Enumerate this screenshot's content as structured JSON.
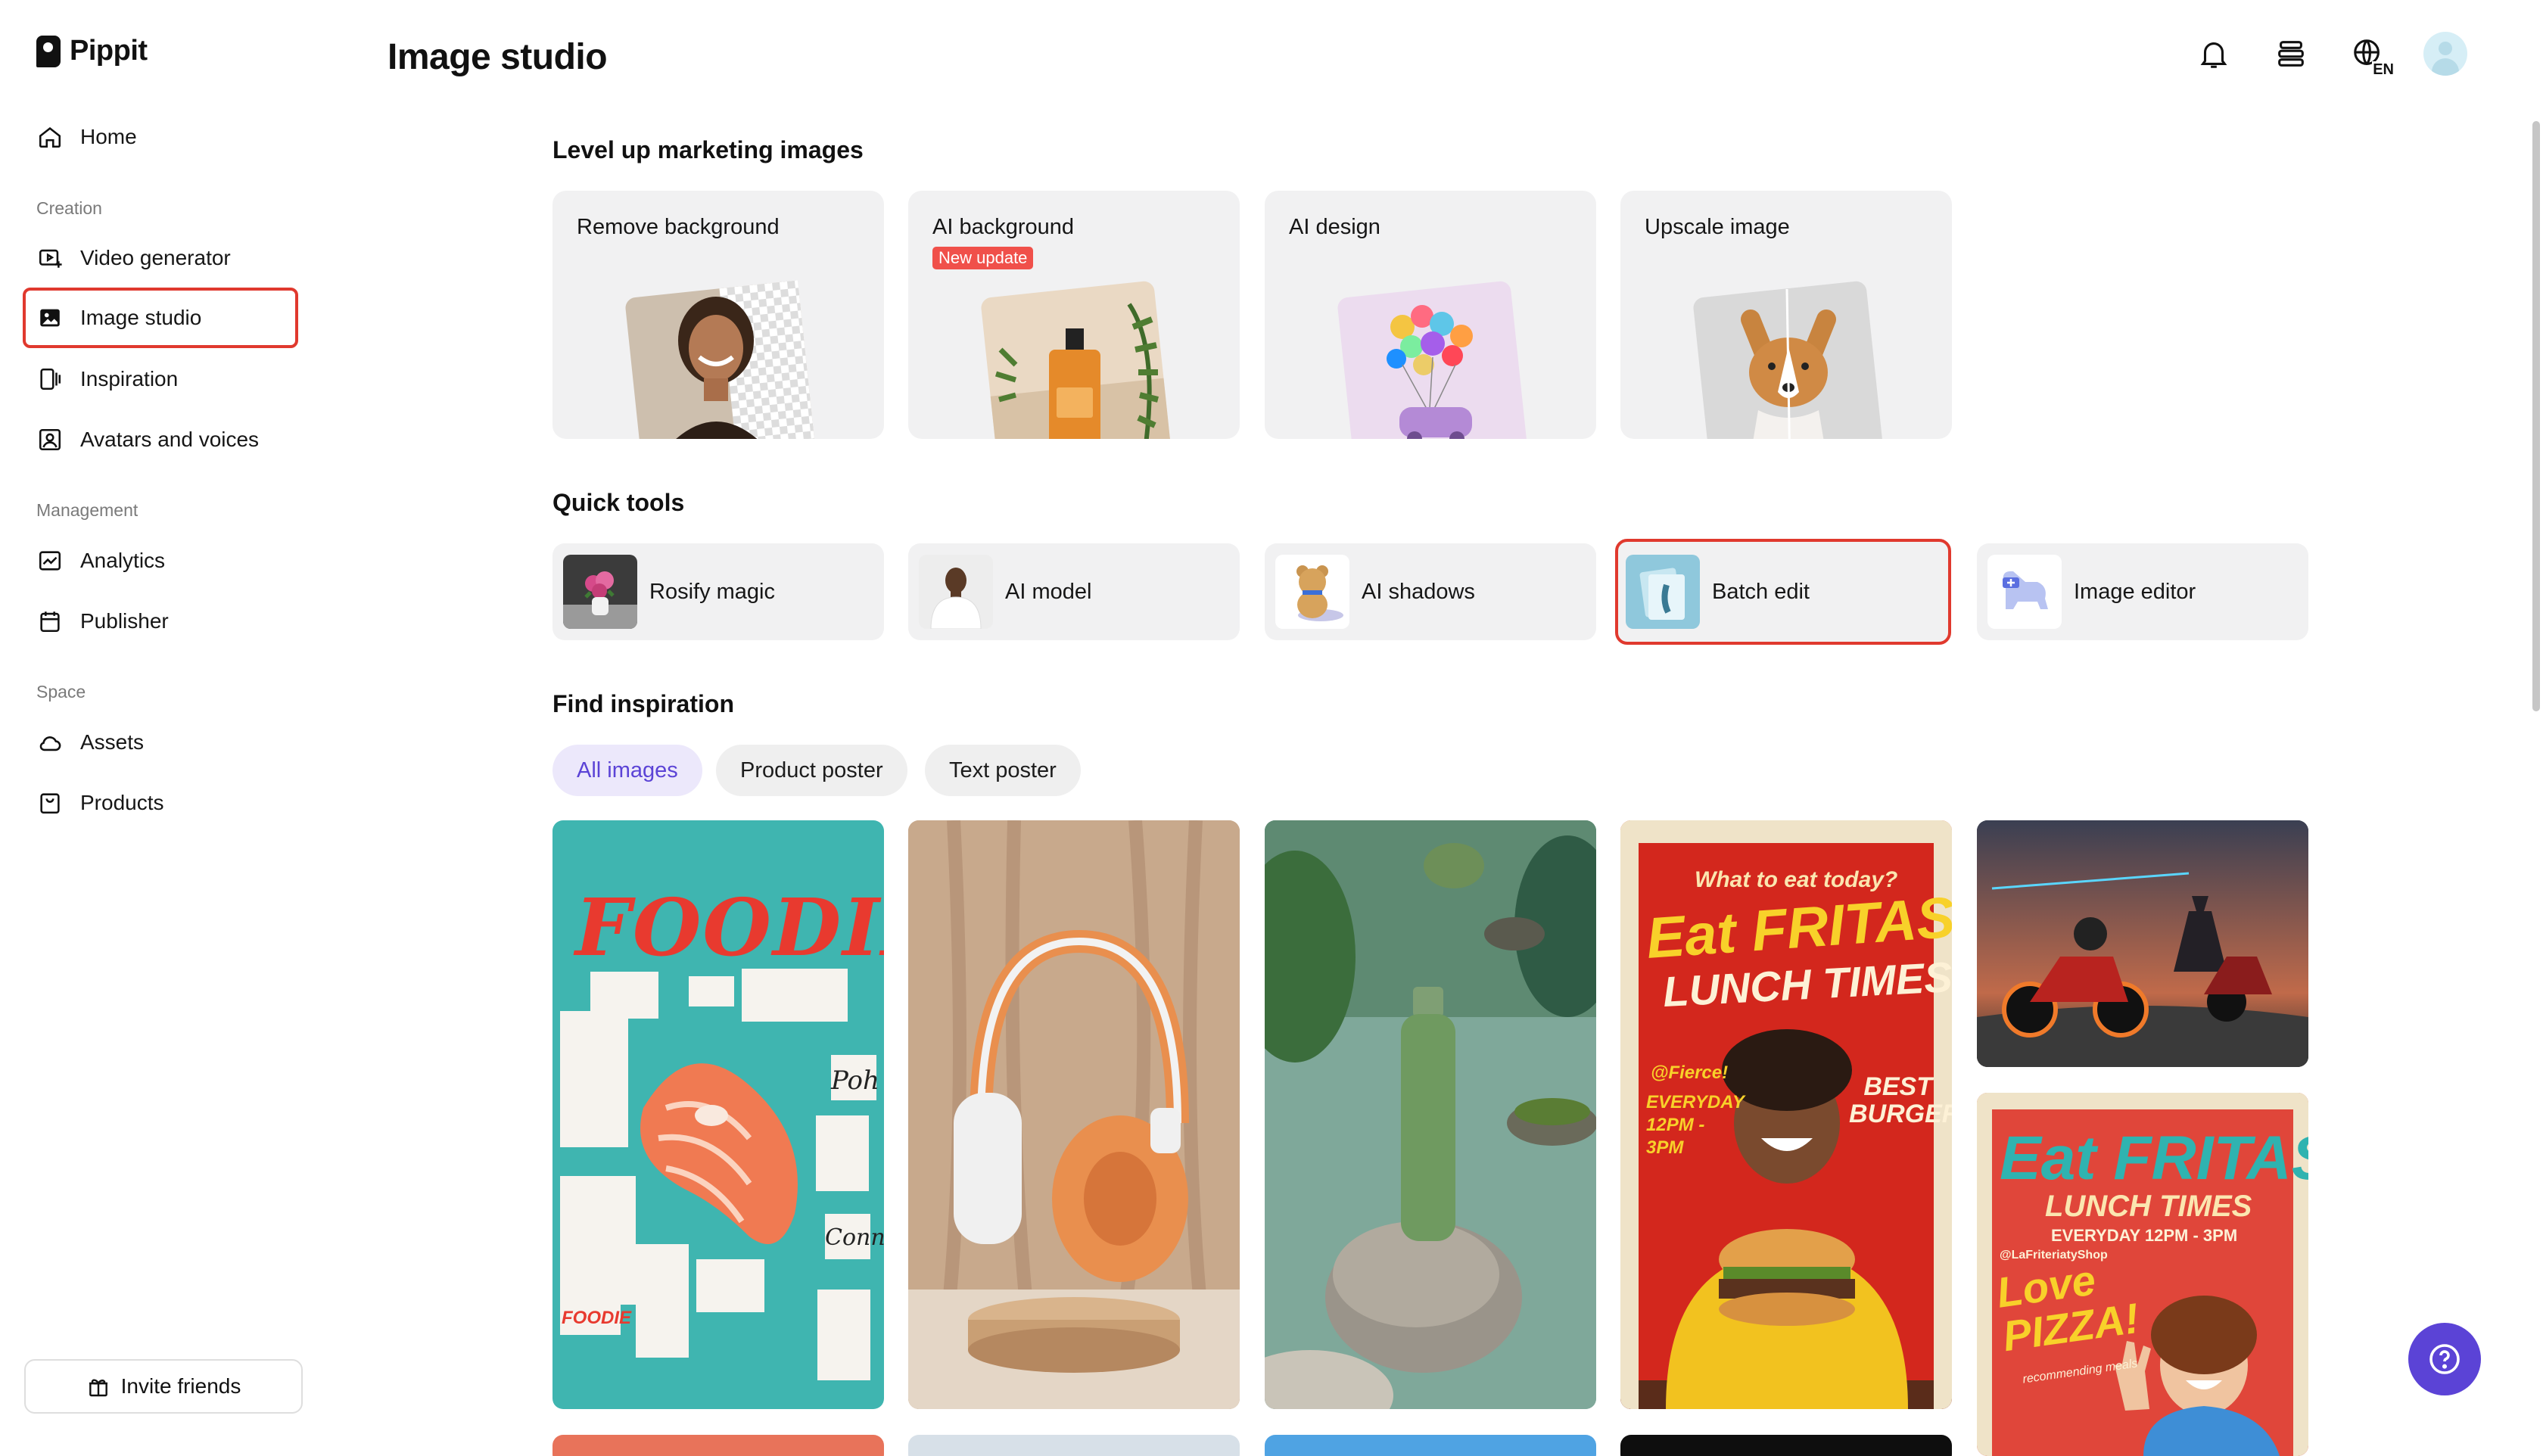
{
  "app": {
    "name": "Pippit"
  },
  "sidebar": {
    "home": "Home",
    "creation_label": "Creation",
    "creation": [
      "Video generator",
      "Image studio",
      "Inspiration",
      "Avatars and voices"
    ],
    "management_label": "Management",
    "management": [
      "Analytics",
      "Publisher"
    ],
    "space_label": "Space",
    "space": [
      "Assets",
      "Products"
    ],
    "selected": "Image studio",
    "invite": "Invite friends"
  },
  "header": {
    "title": "Image studio",
    "language": "EN",
    "icons": [
      "bell-icon",
      "layers-icon",
      "globe-icon",
      "user-avatar"
    ]
  },
  "marketing": {
    "title": "Level up marketing images",
    "cards": [
      {
        "label": "Remove background",
        "badge": ""
      },
      {
        "label": "AI background",
        "badge": "New update"
      },
      {
        "label": "AI design",
        "badge": ""
      },
      {
        "label": "Upscale image",
        "badge": ""
      }
    ]
  },
  "quick_tools": {
    "title": "Quick tools",
    "items": [
      "Rosify magic",
      "AI model",
      "AI shadows",
      "Batch edit",
      "Image editor"
    ],
    "selected": "Batch edit"
  },
  "inspiration": {
    "title": "Find inspiration",
    "filters": [
      "All images",
      "Product poster",
      "Text poster"
    ],
    "active_filter": "All images",
    "posters": {
      "foodie": {
        "headline": "FOODIE",
        "tag": "FOODIE",
        "side1": "Poh",
        "side2": "Conn"
      },
      "fritas1": {
        "question": "What to eat today?",
        "headline": "Eat FRITAS!",
        "sub": "LUNCH TIMES",
        "handle": "@Fierce!",
        "time": "EVERYDAY 12PM - 3PM",
        "best": "BEST BURGER!"
      },
      "fritas2": {
        "headline": "Eat FRITAS!",
        "sub": "LUNCH TIMES",
        "time": "EVERYDAY 12PM - 3PM",
        "handle": "@LaFriteriatyShop",
        "love": "Love PIZZA!",
        "rec": "recommending meals"
      }
    }
  },
  "colors": {
    "accent": "#5b43d6",
    "selection": "#e0392e",
    "card_bg": "#f1f1f2",
    "badge": "#f0504a"
  }
}
